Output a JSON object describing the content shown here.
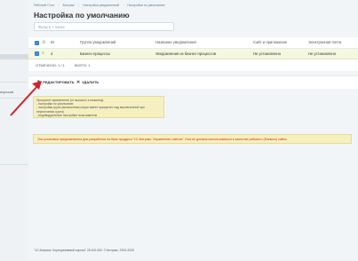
{
  "sidebar": {
    "label": "ецессов"
  },
  "breadcrumb": [
    "Рабочий Стол",
    "Битрикс",
    "Настройки уведомлений",
    "Настройки по умолчанию"
  ],
  "page": {
    "title": "Настройка по умолчанию",
    "star": "☆"
  },
  "search": {
    "placeholder": "Фильтр + поиск"
  },
  "table": {
    "columns": [
      "ID",
      "Группа уведомлений",
      "Название уведомления",
      "Сайт и приложение",
      "Электронная почта"
    ],
    "rows": [
      {
        "id": "4",
        "group": "Бизнес-процессы",
        "name": "Уведомления из бизнес-процессов",
        "site": "Не установлено",
        "email": "Не установлено"
      }
    ],
    "selected_text": "ОТМЕЧЕНО: 1 / 1",
    "total_text": "ВСЕГО: 1"
  },
  "actions": {
    "edit_label": "РЕДАКТИРОВАТЬ",
    "delete_label": "УДАЛИТЬ"
  },
  "note": {
    "lines": [
      "Приоритет применения (от высшего к низшему):",
      "- настройки по умолчанию",
      "- настройки групп (включенная опция имеет приоритет над выключенной при пересечении групп)",
      "- индивидуальные настройки пользователя"
    ]
  },
  "warning": {
    "text": "Эта установка предназначена для разработки на базе продукта \"1С-Битрикс: Управление сайтом\". Она не должна использоваться в качестве рабочего (боевого) сайта."
  },
  "footer": {
    "copyright": "\"1С-Битрикс: Корпоративный портал\" 25.100.400. © Битрикс, 2002-2025"
  },
  "colors": {
    "accent": "#2b7cdc",
    "selected_row": "#f4f8df",
    "note_bg": "#f6f0c0",
    "warning_text": "#d12c1f",
    "arrow": "#d0242b"
  }
}
